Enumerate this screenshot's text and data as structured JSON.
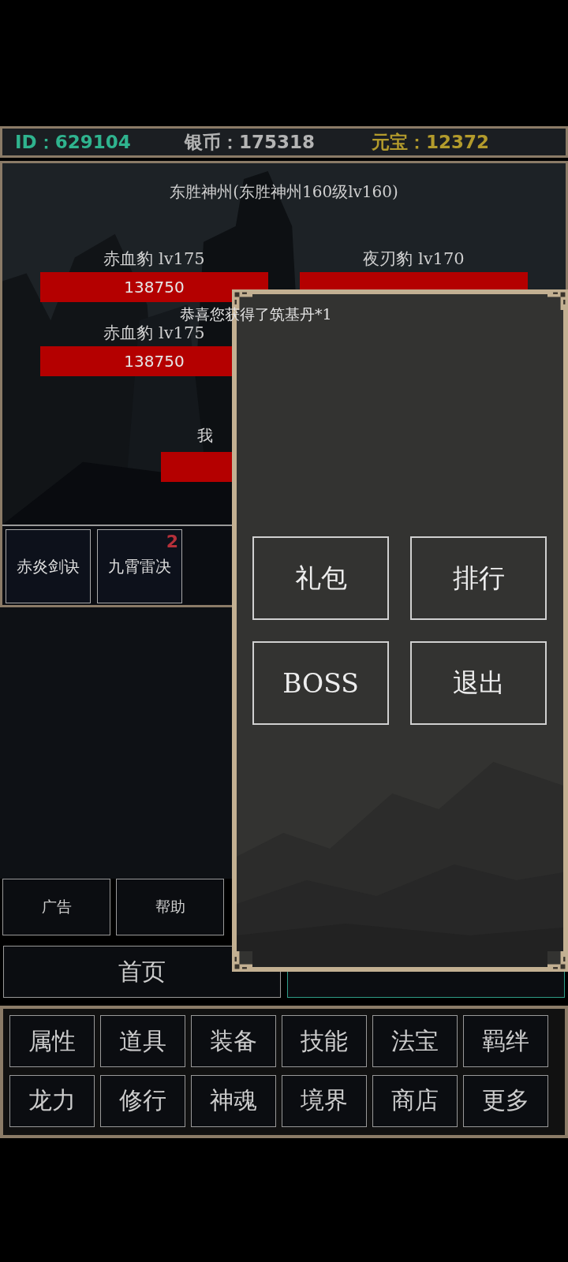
{
  "stats": [
    {
      "text": "ID：629104",
      "kind": "id"
    },
    {
      "text": "银币：175318",
      "kind": "silver"
    },
    {
      "text": "元宝：12372",
      "kind": "ingot"
    }
  ],
  "battle": {
    "map_title": "东胜神州(东胜神州160级lv160)",
    "enemies": [
      {
        "name": "赤血豹 lv175",
        "hp": "138750",
        "level": 1
      },
      {
        "name": "夜刃豹 lv170",
        "level": 1
      },
      {
        "name": "赤血豹 lv175",
        "hp": "138750",
        "level": 1
      }
    ],
    "challenge": {
      "label": "我",
      "level": 1
    },
    "skills": [
      {
        "name": "赤炎剑诀"
      },
      {
        "name": "九霄雷决",
        "badge": "2"
      }
    ]
  },
  "actions": [
    "广告",
    "帮助"
  ],
  "tabs": [
    {
      "label": "首页",
      "selected": false
    },
    {
      "selected": true
    }
  ],
  "menu": [
    "属性",
    "道具",
    "装备",
    "技能",
    "法宝",
    "羁绊",
    "龙力",
    "修行",
    "神魂",
    "境界",
    "商店",
    "更多"
  ],
  "popup": {
    "buttons": [
      "礼包",
      "排行",
      "BOSS",
      "退出"
    ]
  },
  "toast": "恭喜您获得了筑基丹*1"
}
